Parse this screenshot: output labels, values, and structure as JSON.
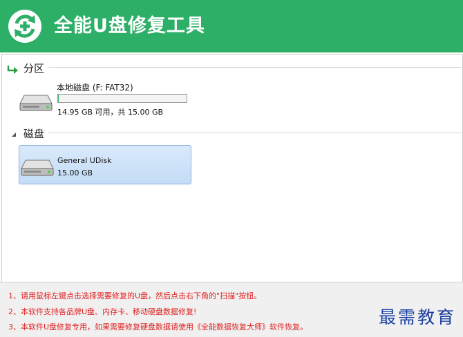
{
  "app": {
    "title": "全能U盘修复工具"
  },
  "partitions": {
    "group_label": "分区",
    "items": [
      {
        "name": "本地磁盘 (F: FAT32)",
        "usage_fraction": 0.003,
        "size_text": "14.95 GB 可用，共 15.00 GB"
      }
    ]
  },
  "disks": {
    "group_label": "磁盘",
    "items": [
      {
        "name": "General UDisk",
        "size": "15.00 GB"
      }
    ]
  },
  "tips": [
    "1、请用鼠标左键点击选择需要修复的U盘，然后点击右下角的\"扫描\"按钮。",
    "2、本软件支持各品牌U盘、内存卡、移动硬盘数据修复!",
    "3、本软件U盘修复专用，如果需要修复硬盘数据请使用《全能数据恢复大师》软件恢复。"
  ],
  "watermark": "最需教育",
  "colors": {
    "header": "#2eaf68",
    "tip_text": "#e02222",
    "selection": "#c4dcf6",
    "watermark": "#1a3fa0"
  },
  "icons": {
    "logo": "refresh-plus-icon",
    "partition_toggle": "green-arrow-icon",
    "disk_toggle": "triangle-collapse-icon",
    "drive": "hard-drive-icon"
  }
}
